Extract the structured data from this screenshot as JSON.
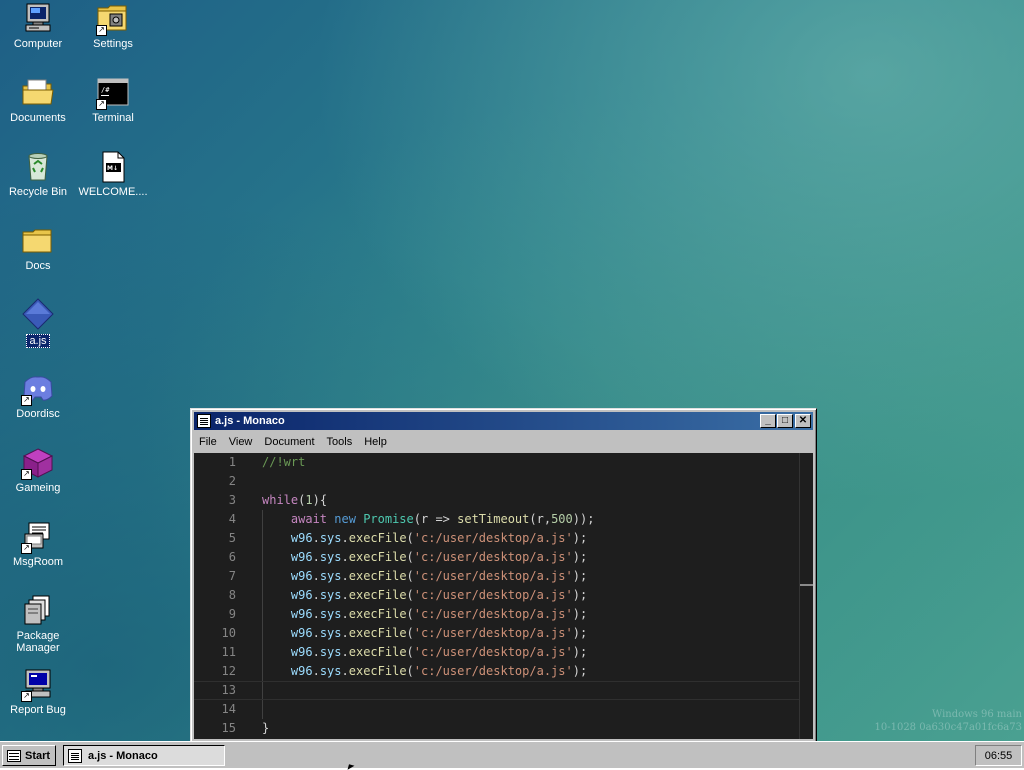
{
  "desktop": {
    "icons": [
      {
        "label": "Computer",
        "icon": "computer-icon"
      },
      {
        "label": "Settings",
        "icon": "settings-icon"
      },
      {
        "label": "Documents",
        "icon": "documents-folder-icon"
      },
      {
        "label": "Terminal",
        "icon": "terminal-icon"
      },
      {
        "label": "Recycle Bin",
        "icon": "recycle-bin-icon"
      },
      {
        "label": "WELCOME....",
        "icon": "markdown-file-icon"
      },
      {
        "label": "Docs",
        "icon": "folder-icon"
      },
      {
        "label": "a.js",
        "icon": "js-file-icon"
      },
      {
        "label": "Doordisc",
        "icon": "discord-icon"
      },
      {
        "label": "Gameing",
        "icon": "game-cube-icon"
      },
      {
        "label": "MsgRoom",
        "icon": "msgroom-icon"
      },
      {
        "label": "Package Manager",
        "icon": "package-manager-icon"
      },
      {
        "label": "Report Bug",
        "icon": "report-bug-icon"
      }
    ],
    "watermark": {
      "line1": "Windows 96 main",
      "line2": "10-1028 0a630c47a01fc6a73"
    }
  },
  "window": {
    "title": "a.js - Monaco",
    "minimize": "_",
    "maximize": "□",
    "close": "✕",
    "menu": [
      "File",
      "View",
      "Document",
      "Tools",
      "Help"
    ]
  },
  "editor": {
    "line_numbers": [
      "1",
      "2",
      "3",
      "4",
      "5",
      "6",
      "7",
      "8",
      "9",
      "10",
      "11",
      "12",
      "13",
      "14",
      "15"
    ],
    "lines": [
      "//!wrt",
      "",
      "while(1){",
      "    await new Promise(r => setTimeout(r,500));",
      "    w96.sys.execFile('c:/user/desktop/a.js');",
      "    w96.sys.execFile('c:/user/desktop/a.js');",
      "    w96.sys.execFile('c:/user/desktop/a.js');",
      "    w96.sys.execFile('c:/user/desktop/a.js');",
      "    w96.sys.execFile('c:/user/desktop/a.js');",
      "    w96.sys.execFile('c:/user/desktop/a.js');",
      "    w96.sys.execFile('c:/user/desktop/a.js');",
      "    w96.sys.execFile('c:/user/desktop/a.js');",
      "",
      "",
      "}"
    ],
    "current_line": 13
  },
  "taskbar": {
    "start_label": "Start",
    "task_label": "a.js - Monaco",
    "clock": "06:55"
  }
}
